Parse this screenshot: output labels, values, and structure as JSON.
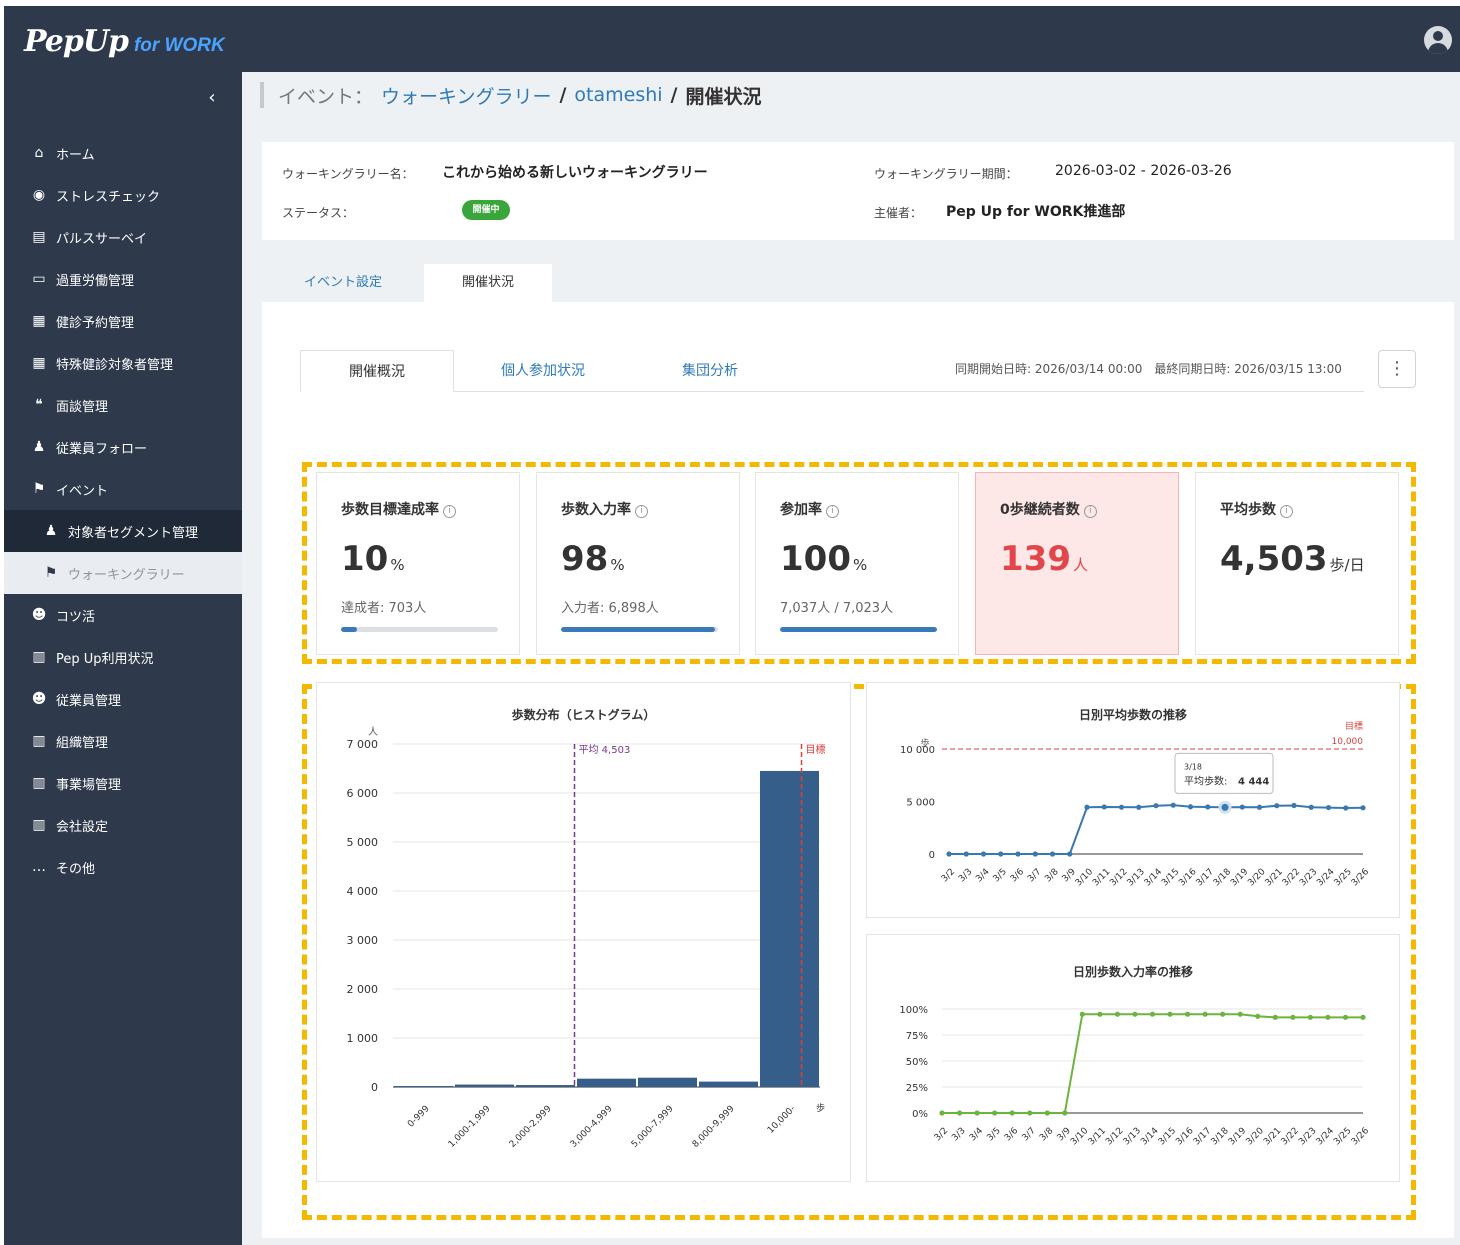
{
  "app": {
    "logo": "PepUp",
    "logo_sub": "for WORK"
  },
  "sidebar": {
    "items": [
      {
        "label": "ホーム",
        "icon": "home-icon"
      },
      {
        "label": "ストレスチェック",
        "icon": "stress-check-icon"
      },
      {
        "label": "パルスサーベイ",
        "icon": "clipboard-icon"
      },
      {
        "label": "過重労働管理",
        "icon": "briefcase-icon"
      },
      {
        "label": "健診予約管理",
        "icon": "calendar-icon"
      },
      {
        "label": "特殊健診対象者管理",
        "icon": "calendar-icon"
      },
      {
        "label": "面談管理",
        "icon": "chat-icon"
      },
      {
        "label": "従業員フォロー",
        "icon": "people-icon"
      },
      {
        "label": "イベント",
        "icon": "bookmark-icon"
      },
      {
        "label": "対象者セグメント管理",
        "icon": "people-icon"
      },
      {
        "label": "ウォーキングラリー",
        "icon": "bookmark-icon"
      },
      {
        "label": "コツ活",
        "icon": "group-icon"
      },
      {
        "label": "Pep Up利用状況",
        "icon": "building-icon"
      },
      {
        "label": "従業員管理",
        "icon": "group-icon"
      },
      {
        "label": "組織管理",
        "icon": "building-icon"
      },
      {
        "label": "事業場管理",
        "icon": "building-icon"
      },
      {
        "label": "会社設定",
        "icon": "building-icon"
      },
      {
        "label": "その他",
        "icon": "more-icon"
      }
    ]
  },
  "breadcrumb": {
    "prefix": "イベント：",
    "link1": "ウォーキングラリー",
    "sep": "/",
    "link2": "otameshi",
    "current": "開催状況"
  },
  "event": {
    "name_label": "ウォーキングラリー名：",
    "name": "これから始める新しいウォーキングラリー",
    "status_label": "ステータス：",
    "status": "開催中",
    "period_label": "ウォーキングラリー期間：",
    "period": "2026-03-02 - 2026-03-26",
    "host_label": "主催者：",
    "host": "Pep Up for WORK推進部"
  },
  "tabs": [
    "イベント設定",
    "開催状況"
  ],
  "subtabs": [
    "開催概況",
    "個人参加状況",
    "集団分析"
  ],
  "sync": "同期開始日時: 2026/03/14 00:00　最終同期日時: 2026/03/15 13:00",
  "kpis": [
    {
      "title": "歩数目標達成率",
      "value": "10",
      "unit": "%",
      "sub": "達成者: 703人",
      "progress": 0.1
    },
    {
      "title": "歩数入力率",
      "value": "98",
      "unit": "%",
      "sub": "入力者: 6,898人",
      "progress": 0.98
    },
    {
      "title": "参加率",
      "value": "100",
      "unit": "%",
      "sub": "7,037人 / 7,023人",
      "progress": 1.0
    },
    {
      "title": "0歩継続者数",
      "value": "139",
      "unit": "人"
    },
    {
      "title": "平均歩数",
      "value": "4,503",
      "unit": "歩/日"
    }
  ],
  "colors": {
    "accent": "#2f7ab8",
    "bar": "#355f8a",
    "line_blue": "#3a78b0",
    "line_green": "#6cb33f",
    "alert": "#e0464a",
    "dash": "#f5b800"
  },
  "chart_data": [
    {
      "type": "bar",
      "title": "歩数分布（ヒストグラム）",
      "ylabel": "人",
      "xlabel": "歩",
      "categories": [
        "0-999",
        "1,000-1,999",
        "2,000-2,999",
        "3,000-4,999",
        "5,000-7,999",
        "8,000-9,999",
        "10,000-"
      ],
      "values": [
        20,
        50,
        40,
        170,
        190,
        110,
        6450
      ],
      "ylim": [
        0,
        7000
      ],
      "yticks": [
        "0",
        "1 000",
        "2 000",
        "3 000",
        "4 000",
        "5 000",
        "6 000",
        "7 000"
      ],
      "annotations": [
        {
          "label": "平均 4,503",
          "x": 4503
        },
        {
          "label": "目標",
          "x": 10000
        }
      ]
    },
    {
      "type": "line",
      "title": "日別平均歩数の推移",
      "ylabel": "歩",
      "x": [
        "3/2",
        "3/3",
        "3/4",
        "3/5",
        "3/6",
        "3/7",
        "3/8",
        "3/9",
        "3/10",
        "3/11",
        "3/12",
        "3/13",
        "3/14",
        "3/15",
        "3/16",
        "3/17",
        "3/18",
        "3/19",
        "3/20",
        "3/21",
        "3/22",
        "3/23",
        "3/24",
        "3/25",
        "3/26"
      ],
      "values": [
        0,
        0,
        0,
        0,
        0,
        0,
        0,
        0,
        4450,
        4480,
        4460,
        4450,
        4600,
        4650,
        4500,
        4480,
        4444,
        4470,
        4450,
        4600,
        4620,
        4450,
        4420,
        4380,
        4400
      ],
      "ylim": [
        0,
        10000
      ],
      "yticks": [
        "0",
        "5 000",
        "10 000"
      ],
      "target": {
        "label": "目標",
        "value_label": "10,000",
        "value": 10000
      },
      "tooltip": {
        "date": "3/18",
        "label": "平均歩数:",
        "value": "4 444"
      }
    },
    {
      "type": "line",
      "title": "日別歩数入力率の推移",
      "x": [
        "3/2",
        "3/3",
        "3/4",
        "3/5",
        "3/6",
        "3/7",
        "3/8",
        "3/9",
        "3/10",
        "3/11",
        "3/12",
        "3/13",
        "3/14",
        "3/15",
        "3/16",
        "3/17",
        "3/18",
        "3/19",
        "3/20",
        "3/21",
        "3/22",
        "3/23",
        "3/24",
        "3/25",
        "3/26"
      ],
      "values": [
        0,
        0,
        0,
        0,
        0,
        0,
        0,
        0,
        95,
        95,
        95,
        95,
        95,
        95,
        95,
        95,
        95,
        95,
        93,
        92,
        92,
        92,
        92,
        92,
        92
      ],
      "ylim": [
        0,
        100
      ],
      "yticks": [
        "0%",
        "25%",
        "50%",
        "75%",
        "100%"
      ]
    }
  ]
}
